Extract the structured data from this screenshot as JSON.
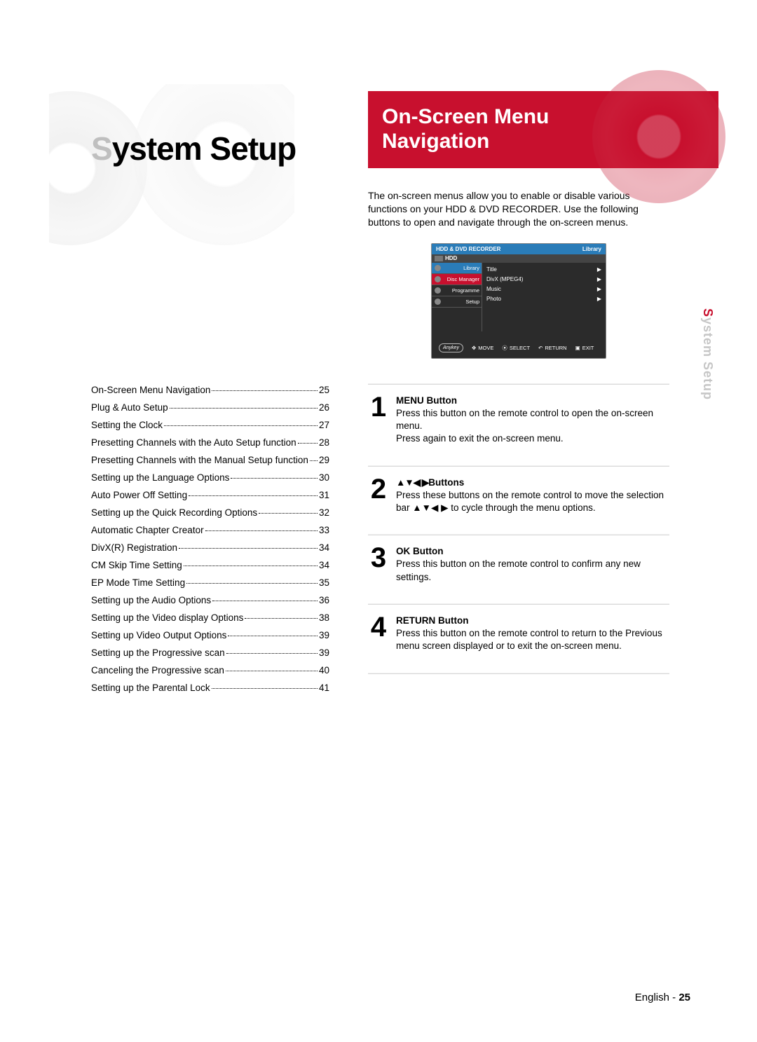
{
  "left": {
    "title_accent": "S",
    "title_rest": "ystem Setup"
  },
  "toc": [
    {
      "label": "On-Screen Menu Navigation",
      "page": "25"
    },
    {
      "label": "Plug & Auto Setup",
      "page": "26"
    },
    {
      "label": "Setting the Clock",
      "page": "27"
    },
    {
      "label": "Presetting Channels with the Auto Setup function",
      "page": "28"
    },
    {
      "label": "Presetting Channels with the Manual Setup function",
      "page": "29"
    },
    {
      "label": "Setting up the Language Options",
      "page": "30"
    },
    {
      "label": "Auto Power Off Setting",
      "page": "31"
    },
    {
      "label": "Setting up the Quick Recording Options",
      "page": "32"
    },
    {
      "label": "Automatic Chapter Creator",
      "page": "33"
    },
    {
      "label": "DivX(R) Registration",
      "page": "34"
    },
    {
      "label": "CM Skip Time Setting",
      "page": "34"
    },
    {
      "label": "EP Mode Time Setting",
      "page": "35"
    },
    {
      "label": "Setting up the Audio Options",
      "page": "36"
    },
    {
      "label": "Setting up the Video display Options",
      "page": "38"
    },
    {
      "label": "Setting up Video Output Options",
      "page": "39"
    },
    {
      "label": "Setting up the Progressive scan",
      "page": "39"
    },
    {
      "label": "Canceling the Progressive scan",
      "page": "40"
    },
    {
      "label": "Setting up the Parental Lock",
      "page": "41"
    }
  ],
  "right": {
    "title_line1": "On-Screen Menu",
    "title_line2": "Navigation",
    "intro": "The on-screen menus allow you to enable or disable various functions on your HDD & DVD RECORDER. Use the following buttons to open and navigate through the on-screen menus."
  },
  "menu_shot": {
    "header_left": "HDD & DVD RECORDER",
    "header_right": "Library",
    "sub": "HDD",
    "side": [
      "Library",
      "Disc Manager",
      "Programme",
      "Setup"
    ],
    "main": [
      "Title",
      "DivX (MPEG4)",
      "Music",
      "Photo"
    ],
    "footer_anykey": "Anykey",
    "footer_move": "MOVE",
    "footer_select": "SELECT",
    "footer_return": "RETURN",
    "footer_exit": "EXIT"
  },
  "steps": [
    {
      "num": "1",
      "title": "MENU Button",
      "body_a": "Press this button on the remote control to open the on-screen menu.",
      "body_b": "Press again to exit the on-screen menu."
    },
    {
      "num": "2",
      "title_prefix": "▲▼◀ ▶",
      "title_suffix": "Buttons",
      "body_a": "Press these buttons on the remote control to move the selection bar ▲▼◀ ▶ to cycle through the menu options."
    },
    {
      "num": "3",
      "title": "OK Button",
      "body_a": "Press this button on the remote control to confirm any new settings."
    },
    {
      "num": "4",
      "title": "RETURN Button",
      "body_a": "Press this button on the remote control to return to the Previous menu screen displayed or to exit the on-screen menu."
    }
  ],
  "side_tab": {
    "accent": "S",
    "rest": "ystem Setup"
  },
  "footer": {
    "lang": "English",
    "dash": " - ",
    "page": "25"
  }
}
